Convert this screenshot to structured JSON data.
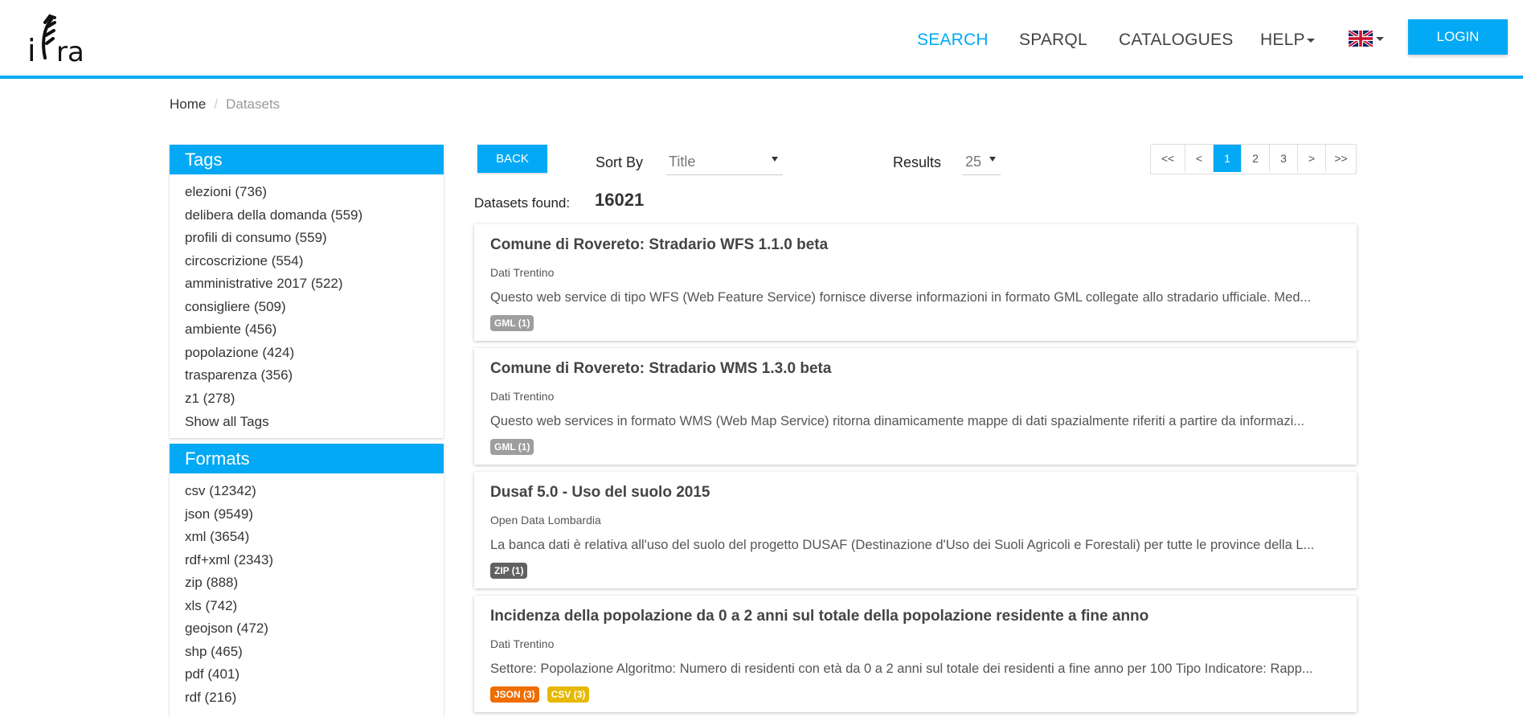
{
  "header": {
    "logo_text": "iDra",
    "nav": [
      {
        "label": "SEARCH",
        "active": true
      },
      {
        "label": "SPARQL",
        "active": false
      },
      {
        "label": "CATALOGUES",
        "active": false
      },
      {
        "label": "HELP",
        "active": false,
        "dropdown": true
      }
    ],
    "language_flag": "uk-flag-icon",
    "login_label": "LOGIN"
  },
  "breadcrumb": {
    "home": "Home",
    "current": "Datasets"
  },
  "tags": {
    "title": "Tags",
    "items": [
      "elezioni (736)",
      "delibera della domanda (559)",
      "profili di consumo (559)",
      "circoscrizione (554)",
      "amministrative 2017 (522)",
      "consigliere (509)",
      "ambiente (456)",
      "popolazione (424)",
      "trasparenza (356)",
      "z1 (278)"
    ],
    "show_all": "Show all Tags"
  },
  "formats": {
    "title": "Formats",
    "items": [
      "csv (12342)",
      "json (9549)",
      "xml (3654)",
      "rdf+xml (2343)",
      "zip (888)",
      "xls (742)",
      "geojson (472)",
      "shp (465)",
      "pdf (401)",
      "rdf (216)"
    ]
  },
  "toolbar": {
    "back_label": "BACK",
    "sort_label": "Sort By",
    "sort_value": "Title",
    "results_label": "Results",
    "results_value": "25"
  },
  "pagination": {
    "first": "<<",
    "prev": "<",
    "pages": [
      "1",
      "2",
      "3"
    ],
    "current": "1",
    "next": ">",
    "last": ">>"
  },
  "summary": {
    "found_label": "Datasets found:",
    "found_count": "16021"
  },
  "datasets": [
    {
      "title": "Comune di Rovereto: Stradario WFS 1.1.0 beta",
      "source": "Dati Trentino",
      "description": "Questo web service di tipo WFS (Web Feature Service) fornisce diverse informazioni in formato GML collegate allo stradario ufficiale. Med...",
      "badges": [
        {
          "label": "GML (1)",
          "color": "#9e9e9e"
        }
      ]
    },
    {
      "title": "Comune di Rovereto: Stradario WMS 1.3.0 beta",
      "source": "Dati Trentino",
      "description": "Questo web services in formato WMS (Web Map Service) ritorna dinamicamente mappe di dati spazialmente riferiti a partire da informazi...",
      "badges": [
        {
          "label": "GML (1)",
          "color": "#9e9e9e"
        }
      ]
    },
    {
      "title": "Dusaf 5.0 - Uso del suolo 2015",
      "source": "Open Data Lombardia",
      "description": "La banca dati è relativa all'uso del suolo del progetto DUSAF (Destinazione d'Uso dei Suoli Agricoli e Forestali) per tutte le province della L...",
      "badges": [
        {
          "label": "ZIP (1)",
          "color": "#616161"
        }
      ]
    },
    {
      "title": "Incidenza della popolazione da 0 a 2 anni sul totale della popolazione residente a fine anno",
      "source": "Dati Trentino",
      "description": "Settore: Popolazione Algoritmo: Numero di residenti con età da 0 a 2 anni sul totale dei residenti a fine anno per 100 Tipo Indicatore: Rapp...",
      "badges": [
        {
          "label": "JSON (3)",
          "color": "#ef6c00"
        },
        {
          "label": "CSV (3)",
          "color": "#e6b800"
        }
      ]
    }
  ],
  "colors": {
    "accent": "#03a9f4"
  }
}
